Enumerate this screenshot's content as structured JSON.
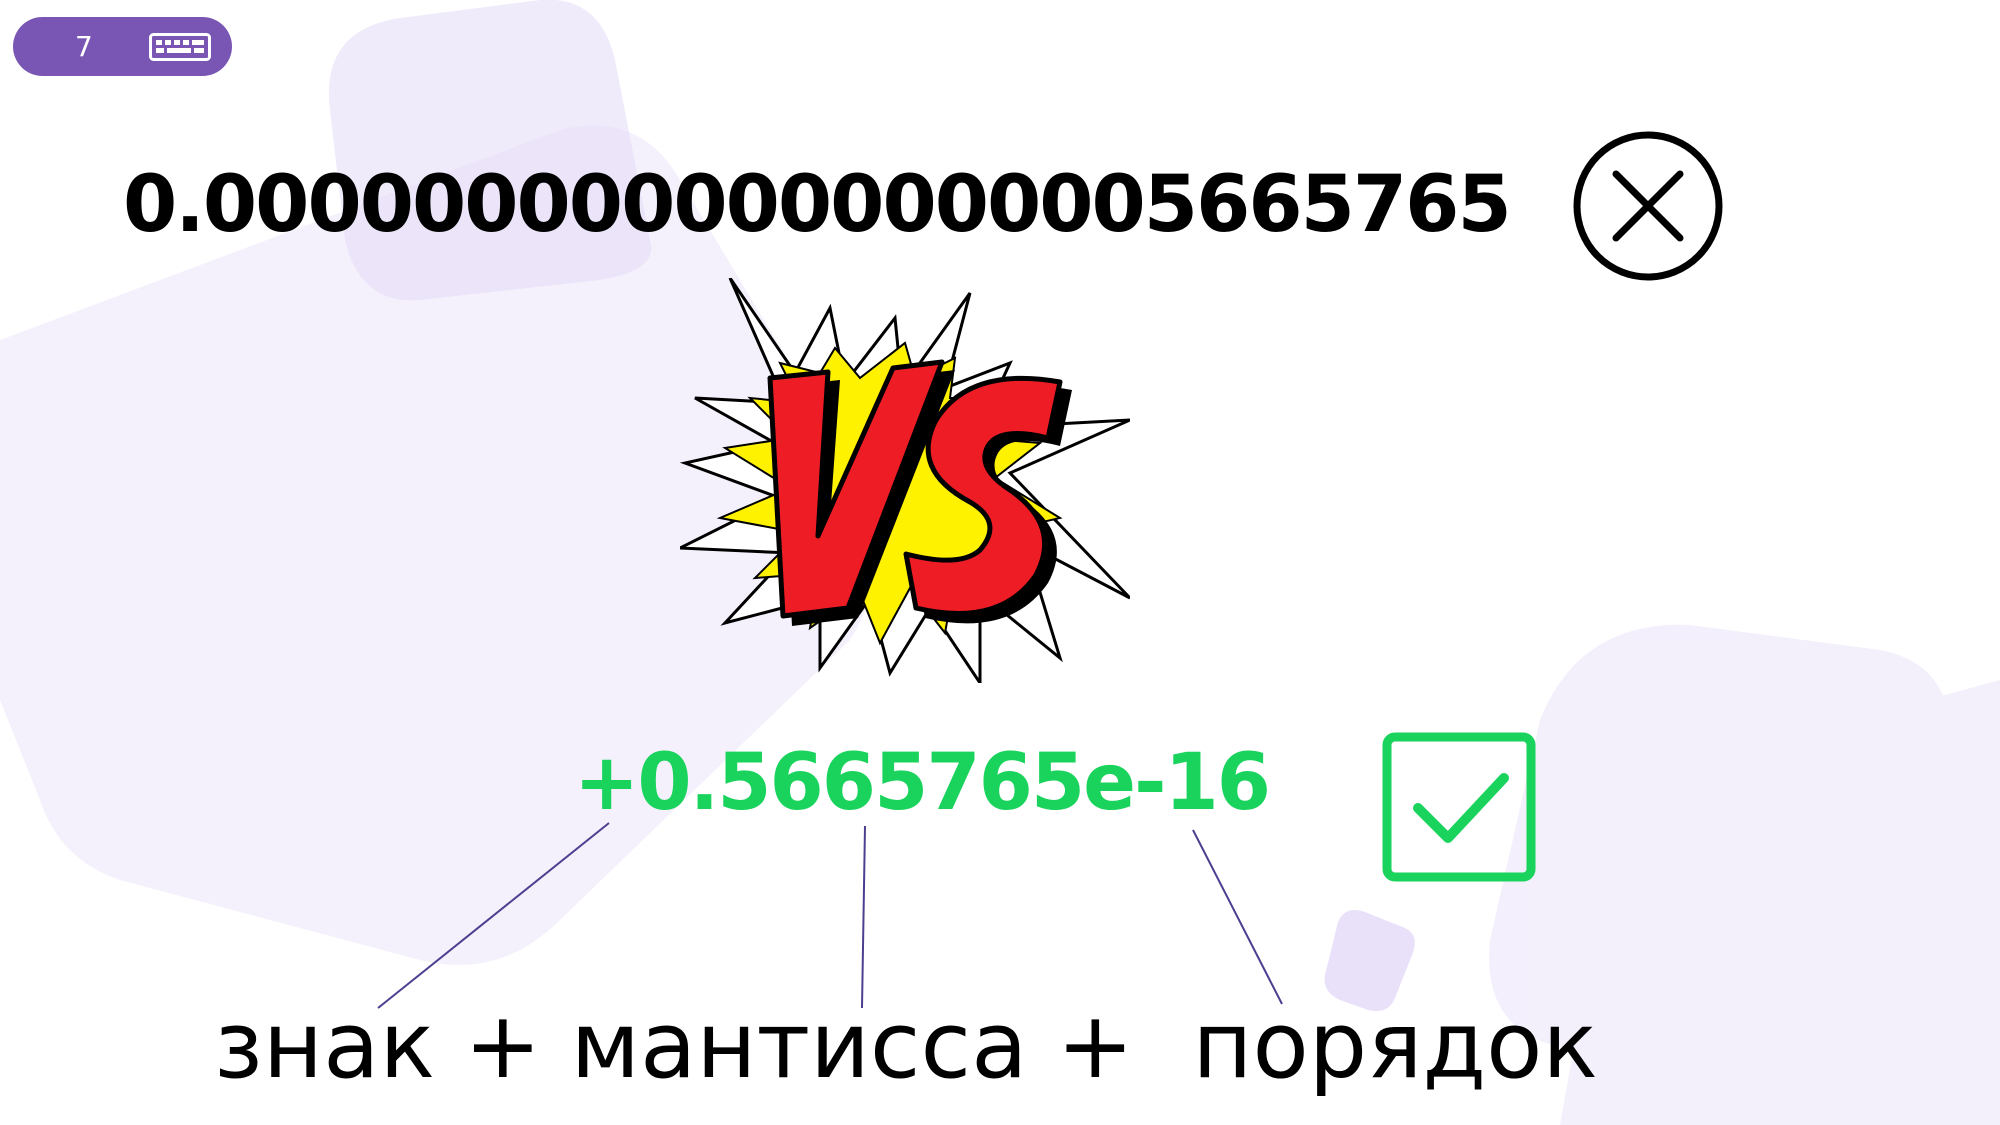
{
  "slide": {
    "number": "7",
    "badge_icon": "keyboard-icon",
    "accent_color": "#7a56b4",
    "background_shape_color": "#ece5fa"
  },
  "main": {
    "decimal_number": "0.0000000000000000005665765",
    "decimal_status_icon": "cross-circle-icon",
    "decimal_color": "#000000",
    "vs_graphic": "vs-comic-burst-icon",
    "scientific_number": "+0.5665765e-16",
    "scientific_status_icon": "check-square-icon",
    "scientific_color": "#19d35c"
  },
  "labels": {
    "sign": "знак",
    "plus_1": "+",
    "mantissa": "мантисса",
    "plus_2": "+",
    "exponent": "порядок"
  }
}
